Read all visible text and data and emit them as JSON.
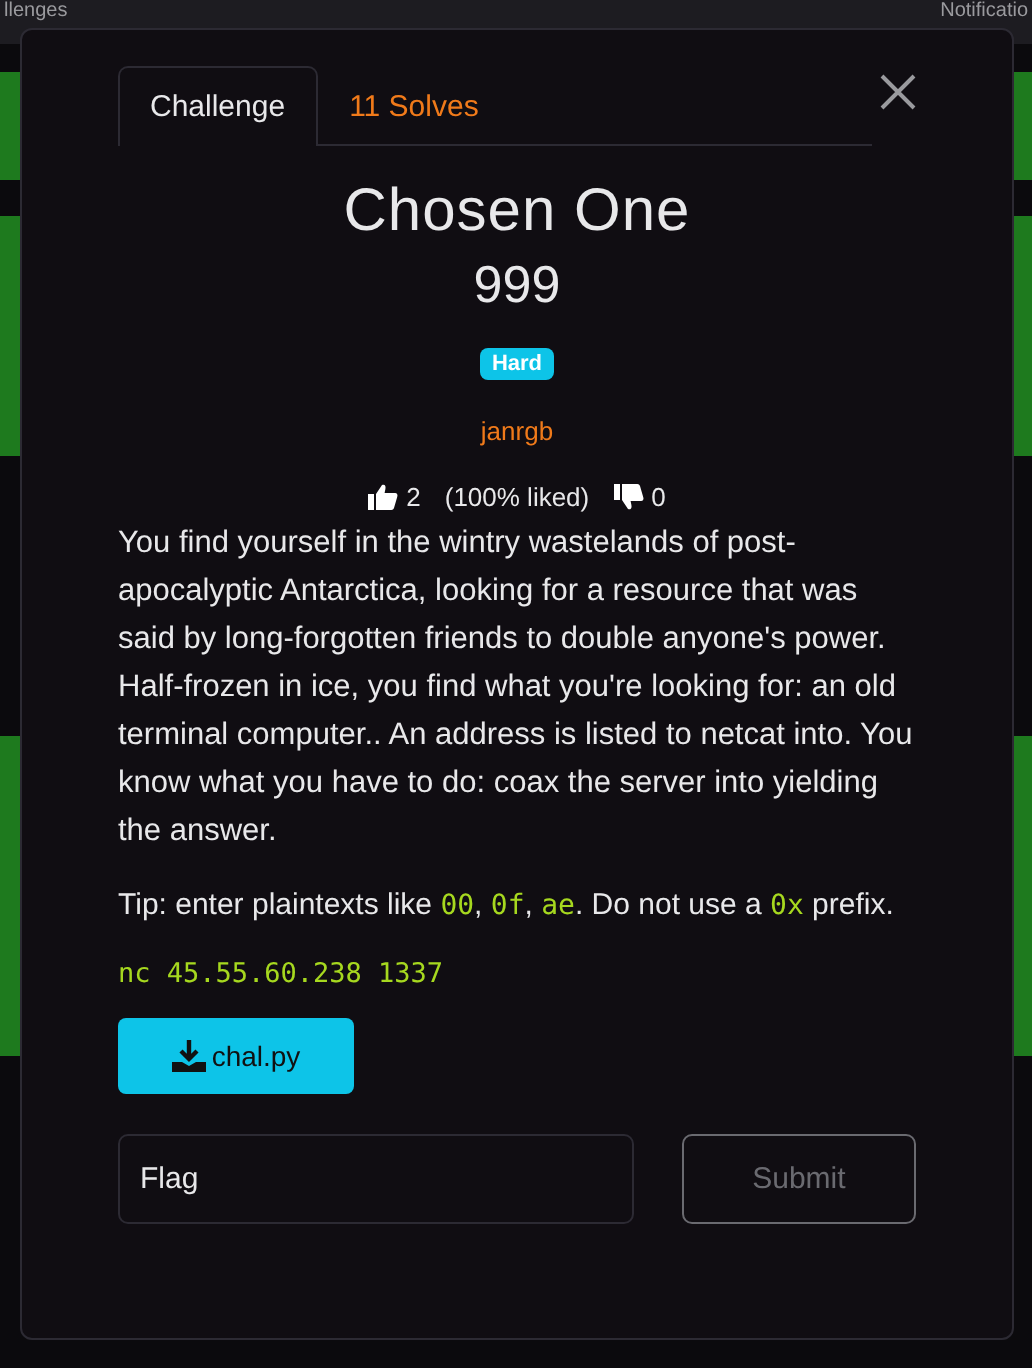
{
  "background": {
    "nav_left": "llenges",
    "nav_right": "Notificatio"
  },
  "tabs": [
    {
      "label": "Challenge",
      "selected": true
    },
    {
      "label": "11 Solves",
      "selected": false
    }
  ],
  "challenge": {
    "name": "Chosen One",
    "points": "999",
    "difficulty": "Hard",
    "author": "janrgb",
    "likes": "2",
    "liked_share": "(100% liked)",
    "dislikes": "0"
  },
  "description": "You find yourself in the wintry wastelands of post-apocalyptic Antarctica, looking for a resource that was said by long-forgotten friends to double anyone's power. Half-frozen in ice, you find what you're looking for: an old terminal computer.. An address is listed to netcat into. You know what you have to do: coax the server into yielding the answer.",
  "tip": [
    {
      "kind": "text",
      "text": "Tip: enter plaintexts like "
    },
    {
      "kind": "code",
      "text": "00"
    },
    {
      "kind": "text",
      "text": ", "
    },
    {
      "kind": "code",
      "text": "0f"
    },
    {
      "kind": "text",
      "text": ", "
    },
    {
      "kind": "code",
      "text": "ae"
    },
    {
      "kind": "text",
      "text": ". Do not use a "
    },
    {
      "kind": "code",
      "text": "0x"
    },
    {
      "kind": "text",
      "text": " prefix."
    }
  ],
  "connection": "nc 45.55.60.238 1337",
  "file": "chal.py",
  "flag_field": {
    "placeholder": "Flag"
  },
  "submit": {
    "label": "Submit",
    "disabled": true
  }
}
